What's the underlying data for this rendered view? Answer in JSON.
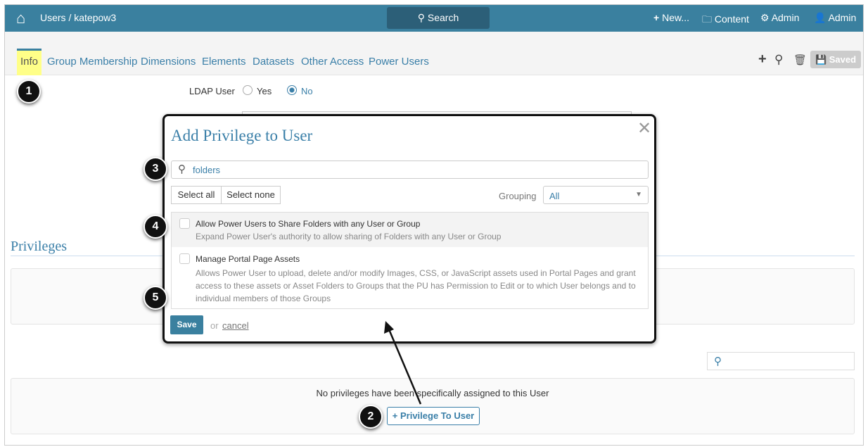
{
  "header": {
    "breadcrumb": "Users / katepow3",
    "search": "Search",
    "new": "New...",
    "content": "Content",
    "admin_settings": "Admin",
    "user": "Admin"
  },
  "tabs": [
    "Info",
    "Group Membership",
    "Dimensions",
    "Elements",
    "Datasets",
    "Other Access",
    "Power Users"
  ],
  "toolbar": {
    "saved": "Saved"
  },
  "form": {
    "ldap_label": "LDAP User",
    "yes": "Yes",
    "no": "No",
    "ldap_value": "No"
  },
  "privileges": {
    "title": "Privileges",
    "empty": "No privileges have been specifically assigned to this User",
    "add_button": "Privilege To User"
  },
  "modal": {
    "title": "Add Privilege to User",
    "search_value": "folders",
    "select_all": "Select all",
    "select_none": "Select none",
    "grouping_label": "Grouping",
    "grouping_value": "All",
    "items": [
      {
        "title": "Allow Power Users to Share Folders with any User or Group",
        "desc": "Expand Power User's authority to allow sharing of Folders with any User or Group"
      },
      {
        "title": "Manage Portal Page Assets",
        "desc": "Allows Power User to upload, delete and/or modify Images, CSS, or JavaScript assets used in Portal Pages and grant access to these assets or Asset Folders to Groups that the PU has Permission to Edit or to which User belongs and to individual members of those Groups"
      }
    ],
    "save": "Save",
    "or": "or",
    "cancel": "cancel"
  },
  "markers": [
    "1",
    "2",
    "3",
    "4",
    "5"
  ]
}
